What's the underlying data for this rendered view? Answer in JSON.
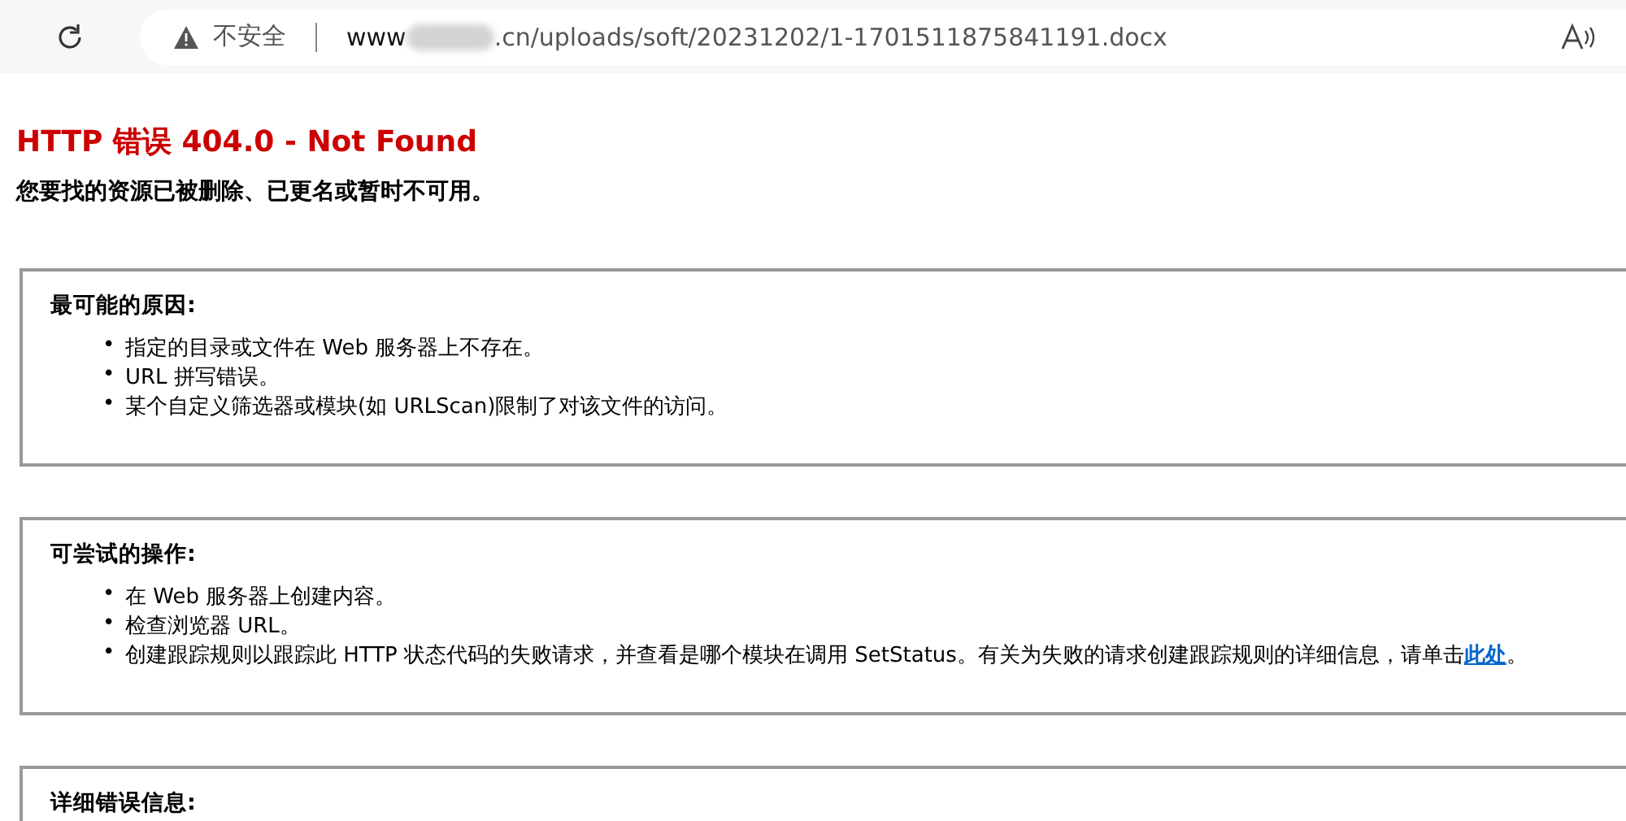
{
  "browser": {
    "security_label": "不安全",
    "url_start": "www",
    "url_end": ".cn/uploads/soft/20231202/1-1701511875841191.docx"
  },
  "page": {
    "title": "HTTP 错误 404.0 - Not Found",
    "subtitle": "您要找的资源已被删除、已更名或暂时不可用。",
    "sections": [
      {
        "heading": "最可能的原因:",
        "items": [
          {
            "marker": "•",
            "text": "指定的目录或文件在 Web 服务器上不存在。"
          },
          {
            "marker": "•",
            "text": "URL 拼写错误。"
          },
          {
            "marker": "•",
            "text": "某个自定义筛选器或模块(如 URLScan)限制了对该文件的访问。"
          }
        ]
      },
      {
        "heading": "可尝试的操作:",
        "items": [
          {
            "marker": "•",
            "text": "在 Web 服务器上创建内容。"
          },
          {
            "marker": "•",
            "text": "检查浏览器 URL。"
          },
          {
            "marker": "•",
            "text": "创建跟踪规则以跟踪此 HTTP 状态代码的失败请求，并查看是哪个模块在调用 SetStatus。有关为失败的请求创建跟踪规则的详细信息，请单击",
            "link": "此处",
            "after": "。"
          }
        ]
      },
      {
        "heading": "详细错误信息:"
      }
    ]
  }
}
